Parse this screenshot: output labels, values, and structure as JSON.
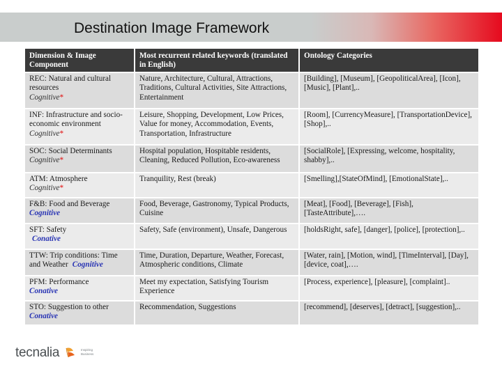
{
  "title": "Destination Image Framework",
  "table": {
    "headers": [
      "Dimension & Image Component",
      "Most recurrent related keywords (translated in English)",
      "Ontology Categories"
    ],
    "rows": [
      {
        "component": "REC: Natural and cultural resources",
        "type": "Cognitive",
        "star": "*",
        "keywords": "Nature, Architecture, Cultural, Attractions, Traditions, Cultural Activities, Site Attractions, Entertainment",
        "ontology": "[Building], [Museum], [GeopoliticalArea], [Icon], [Music], [Plant],.."
      },
      {
        "component": "INF: Infrastructure and socio-economic environment",
        "type": "Cognitive",
        "star": "*",
        "keywords": "Leisure, Shopping, Development, Low Prices, Value for money, Accommodation, Events, Transportation, Infrastructure",
        "ontology": "[Room], [CurrencyMeasure], [TransportationDevice], [Shop],.."
      },
      {
        "component": "SOC: Social Determinants",
        "type": "Cognitive",
        "star": "*",
        "keywords": "Hospital population, Hospitable residents, Cleaning, Reduced Pollution, Eco-awareness",
        "ontology": "[SocialRole], [Expressing, welcome, hospitality, shabby],.."
      },
      {
        "component": "ATM: Atmosphere",
        "type": "Cognitive",
        "star": "*",
        "keywords": "Tranquility, Rest (break)",
        "ontology": "[Smelling],[StateOfMind], [EmotionalState],.."
      },
      {
        "component": "F&B: Food and Beverage",
        "type": "Cognitive",
        "star": "",
        "keywords": "Food, Beverage, Gastronomy, Typical Products, Cuisine",
        "ontology": "[Meat], [Food], [Beverage], [Fish], [TasteAttribute],…."
      },
      {
        "component": "SFT: Safety",
        "type": "Conative",
        "star": "",
        "keywords": "Safety, Safe (environment), Unsafe, Dangerous",
        "ontology": "[holdsRight, safe], [danger], [police], [protection],.."
      },
      {
        "component": "TTW: Trip conditions: Time and Weather",
        "type": "Cognitive",
        "star": "",
        "keywords": "Time, Duration, Departure, Weather, Forecast, Atmospheric conditions, Climate",
        "ontology": "[Water, rain], [Motion, wind], [TimeInterval], [Day], [device, coat],…."
      },
      {
        "component": "PFM: Performance",
        "type": "Conative",
        "star": "",
        "keywords": "Meet my expectation, Satisfying Tourism Experience",
        "ontology": "[Process, experience], [pleasure], [complaint].."
      },
      {
        "component": "STO: Suggestion to other",
        "type": "Conative",
        "star": "",
        "keywords": "Recommendation, Suggestions",
        "ontology": "[recommend], [deserves], [detract], [suggestion],.."
      }
    ]
  },
  "logo": {
    "name": "tecnalia",
    "tagline": "Inspiring Business"
  }
}
